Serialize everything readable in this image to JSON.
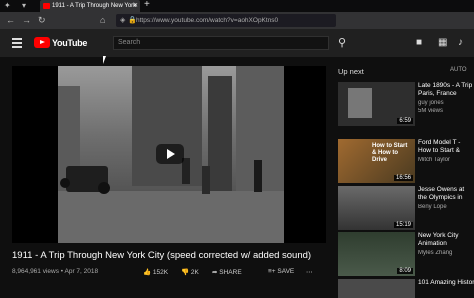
{
  "browser": {
    "tab_title": "1911 - A Trip Through New York",
    "url": "https://www.youtube.com/watch?v=aohXOpKtns0"
  },
  "header": {
    "logo_text": "YouTube",
    "search_placeholder": "Search"
  },
  "video": {
    "title": "1911 - A Trip Through New York City (speed corrected w/ added sound)",
    "views_date": "8,964,961 views • Apr 7, 2018",
    "likes": "152K",
    "dislikes": "2K",
    "share": "SHARE",
    "save": "SAVE"
  },
  "sidebar": {
    "up_next": "Up next",
    "autoplay": "AUTO",
    "items": [
      {
        "title": "Late 1890s - A Trip Paris, France (speed",
        "channel": "guy jones",
        "views": "5M views",
        "duration": "6:59",
        "thumb_color": "#2a2a2a"
      },
      {
        "title": "Ford Model T - How to Start & How to Drive",
        "channel": "Mitch Taylor",
        "views": "",
        "duration": "16:56",
        "thumb_color": "#8a5a2b",
        "thumb_caption1": "How to Start",
        "thumb_caption2": "& How to",
        "thumb_caption3": "Drive"
      },
      {
        "title": "Jesse Owens at the Olympics in 1936",
        "channel": "Beny Lope",
        "views": "",
        "duration": "15:19",
        "thumb_color": "#4a4a4a"
      },
      {
        "title": "New York City Animation",
        "channel": "Myles Zhang",
        "views": "",
        "duration": "8:09",
        "thumb_color": "#3b4a3b"
      },
      {
        "title": "101 Amazing Historic",
        "channel": "",
        "views": "",
        "duration": "",
        "thumb_color": "#555"
      }
    ]
  }
}
